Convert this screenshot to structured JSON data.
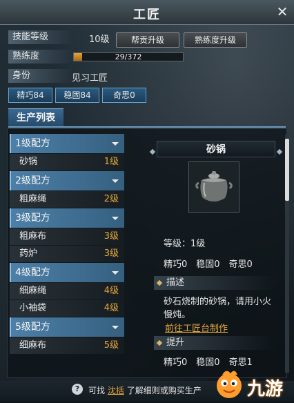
{
  "window": {
    "title": "工匠",
    "close_label": "✕"
  },
  "skill": {
    "label": "技能等级",
    "value": "10级"
  },
  "buttons": {
    "guild_upgrade": "帮贡升级",
    "proficiency_upgrade": "熟练度升级"
  },
  "proficiency": {
    "label": "熟练度",
    "text": "29/372",
    "current": 29,
    "max": 372
  },
  "identity": {
    "label": "身份",
    "value": "见习工匠"
  },
  "stats": {
    "finesse": "精巧84",
    "stability": "稳固84",
    "ingenuity": "奇思0"
  },
  "tab": {
    "label": "生产列表"
  },
  "recipe_groups": [
    {
      "label": "1级配方",
      "items": [
        {
          "name": "砂锅",
          "level": "1级"
        }
      ]
    },
    {
      "label": "2级配方",
      "items": [
        {
          "name": "粗麻绳",
          "level": "2级"
        }
      ]
    },
    {
      "label": "3级配方",
      "items": [
        {
          "name": "粗麻布",
          "level": "3级"
        },
        {
          "name": "药炉",
          "level": "3级"
        }
      ]
    },
    {
      "label": "4级配方",
      "items": [
        {
          "name": "细麻绳",
          "level": "4级"
        },
        {
          "name": "小袖袋",
          "level": "4级"
        }
      ]
    },
    {
      "label": "5级配方",
      "items": [
        {
          "name": "细麻布",
          "level": "5级"
        }
      ]
    }
  ],
  "detail": {
    "name": "砂锅",
    "level_text": "等级：1级",
    "stats_text": "精巧0　稳固0　奇思0",
    "desc_header": "描述",
    "description": "砂石烧制的砂锅，请用小火慢炖。",
    "link": "前往工匠台制作",
    "upgrade_header": "提升",
    "upgrade_stats": "精巧0　稳固0　奇思1"
  },
  "footer": {
    "hint_prefix": "可找",
    "hint_link": "沈括",
    "hint_suffix": "了解细则或购买生产"
  },
  "watermark": {
    "text": "九游"
  }
}
